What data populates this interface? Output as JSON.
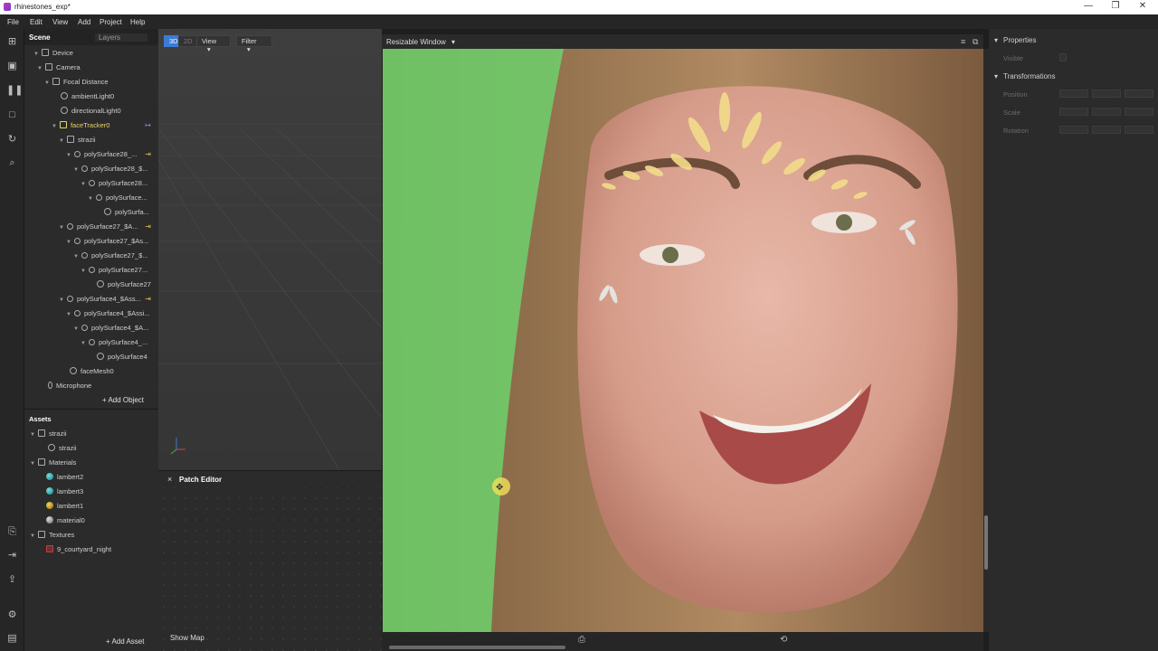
{
  "window": {
    "title": "rhinestones_exp*",
    "minimize": "—",
    "restore": "❐",
    "close": "✕"
  },
  "menu": [
    "File",
    "Edit",
    "View",
    "Add",
    "Project",
    "Help"
  ],
  "scene": {
    "tabs": {
      "scene": "Scene",
      "layers": "Layers"
    },
    "tree": [
      "Device",
      "Camera",
      "Focal Distance",
      "ambientLight0",
      "directionalLight0",
      "faceTracker0",
      "strazii",
      "polySurface28_...",
      "polySurface28_$...",
      "polySurface28...",
      "polySurface...",
      "polySurfa...",
      "polySurface27_$A...",
      "polySurface27_$As...",
      "polySurface27_$...",
      "polySurface27...",
      "polySurface27",
      "polySurface4_$Ass...",
      "polySurface4_$Assi...",
      "polySurface4_$A...",
      "polySurface4_...",
      "polySurface4",
      "faceMesh0",
      "Microphone"
    ],
    "add_object": "+ Add Object"
  },
  "assets": {
    "title": "Assets",
    "items": [
      "strazii",
      "strazii",
      "Materials",
      "lambert2",
      "lambert3",
      "lambert1",
      "material0",
      "Textures",
      "9_courtyard_night"
    ],
    "add_asset": "+ Add Asset",
    "colors": {
      "lambert2": "#2aa8a8",
      "lambert3": "#2aa8a8",
      "lambert1": "#d0a020",
      "material0": "#9a9a9a"
    }
  },
  "viewport": {
    "mode_3d": "3D",
    "mode_2d": "2D",
    "view": "View",
    "filter": "Filter"
  },
  "patch_editor": {
    "close": "×",
    "title": "Patch Editor",
    "show_map": "Show Map"
  },
  "preview": {
    "device": "Resizable Window"
  },
  "properties": {
    "title": "Properties",
    "visible": "Visible",
    "transformations": "Transformations",
    "position": "Position",
    "scale": "Scale",
    "rotation": "Rotation"
  },
  "accent": "#3a7bd5"
}
